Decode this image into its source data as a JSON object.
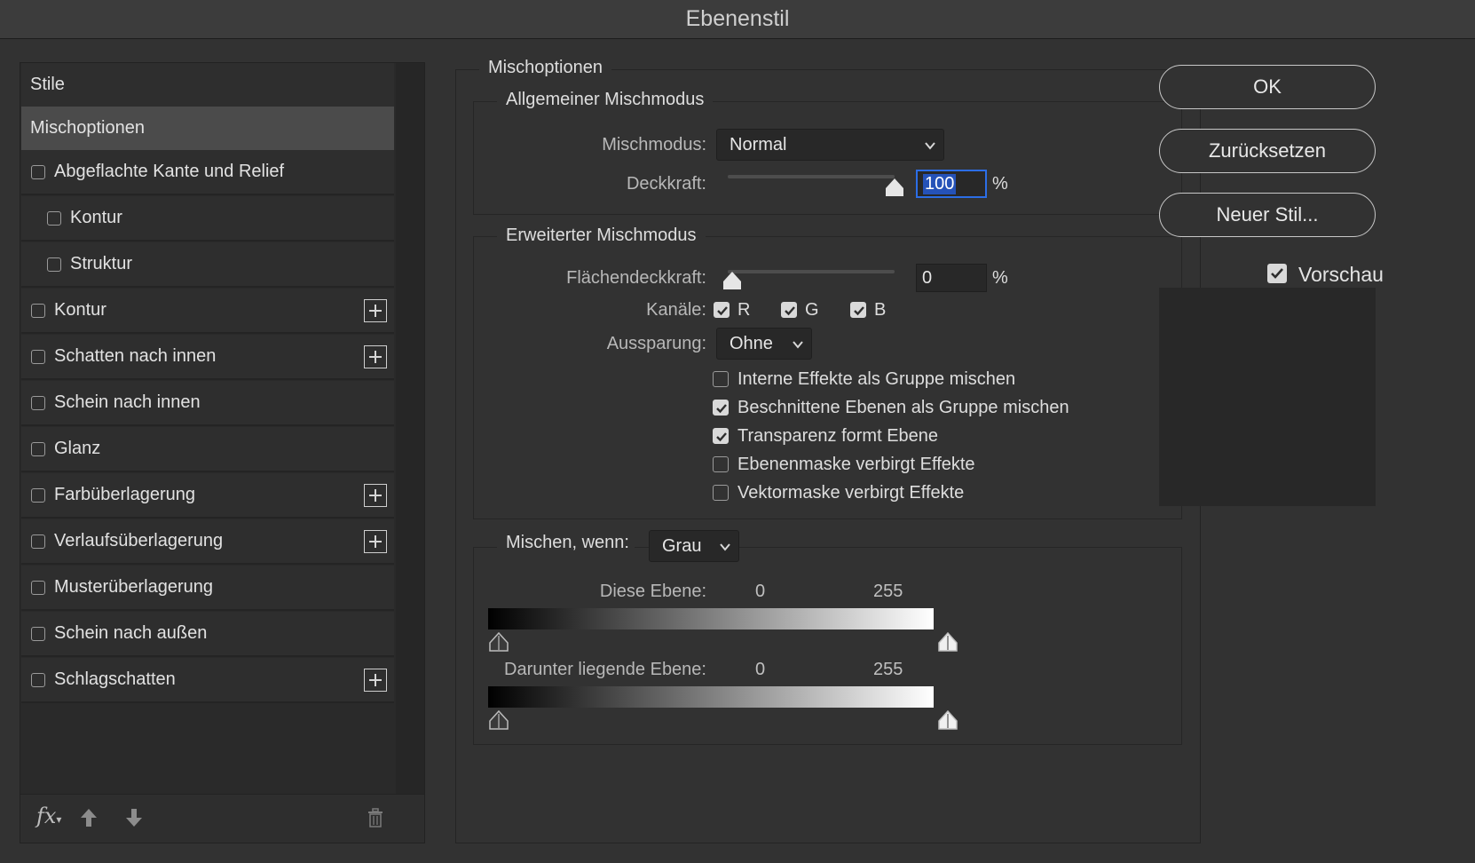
{
  "window": {
    "title": "Ebenenstil"
  },
  "style_list": {
    "header": "Stile",
    "selected": "Mischoptionen",
    "items": [
      {
        "label": "Abgeflachte Kante und Relief",
        "checked": false,
        "plus": false,
        "indent": false
      },
      {
        "label": "Kontur",
        "checked": false,
        "plus": false,
        "indent": true
      },
      {
        "label": "Struktur",
        "checked": false,
        "plus": false,
        "indent": true
      },
      {
        "label": "Kontur",
        "checked": false,
        "plus": true,
        "indent": false
      },
      {
        "label": "Schatten nach innen",
        "checked": false,
        "plus": true,
        "indent": false
      },
      {
        "label": "Schein nach innen",
        "checked": false,
        "plus": false,
        "indent": false
      },
      {
        "label": "Glanz",
        "checked": false,
        "plus": false,
        "indent": false
      },
      {
        "label": "Farbüberlagerung",
        "checked": false,
        "plus": true,
        "indent": false
      },
      {
        "label": "Verlaufsüberlagerung",
        "checked": false,
        "plus": true,
        "indent": false
      },
      {
        "label": "Musterüberlagerung",
        "checked": false,
        "plus": false,
        "indent": false
      },
      {
        "label": "Schein nach außen",
        "checked": false,
        "plus": false,
        "indent": false
      },
      {
        "label": "Schlagschatten",
        "checked": false,
        "plus": true,
        "indent": false
      }
    ],
    "footer": {
      "fx_label": "fx"
    }
  },
  "blend": {
    "title": "Mischoptionen",
    "general": {
      "title": "Allgemeiner Mischmodus",
      "mode_label": "Mischmodus:",
      "mode_value": "Normal",
      "opacity_label": "Deckkraft:",
      "opacity_value": "100",
      "opacity_unit": "%",
      "opacity_fraction": 1.0
    },
    "advanced": {
      "title": "Erweiterter Mischmodus",
      "fill_label": "Flächendeckkraft:",
      "fill_value": "0",
      "fill_unit": "%",
      "fill_fraction": 0.0,
      "channels_label": "Kanäle:",
      "channels": [
        {
          "label": "R",
          "checked": true
        },
        {
          "label": "G",
          "checked": true
        },
        {
          "label": "B",
          "checked": true
        }
      ],
      "knockout_label": "Aussparung:",
      "knockout_value": "Ohne",
      "options": [
        {
          "label": "Interne Effekte als Gruppe mischen",
          "checked": false
        },
        {
          "label": "Beschnittene Ebenen als Gruppe mischen",
          "checked": true
        },
        {
          "label": "Transparenz formt Ebene",
          "checked": true
        },
        {
          "label": "Ebenenmaske verbirgt Effekte",
          "checked": false
        },
        {
          "label": "Vektormaske verbirgt Effekte",
          "checked": false
        }
      ]
    },
    "blend_if": {
      "label": "Mischen, wenn:",
      "value": "Grau",
      "this_layer_label": "Diese Ebene:",
      "this_layer_min": "0",
      "this_layer_max": "255",
      "underlying_label": "Darunter liegende Ebene:",
      "underlying_min": "0",
      "underlying_max": "255"
    }
  },
  "buttons": {
    "ok": "OK",
    "reset": "Zurücksetzen",
    "new_style": "Neuer Stil..."
  },
  "preview": {
    "label": "Vorschau",
    "checked": true
  }
}
